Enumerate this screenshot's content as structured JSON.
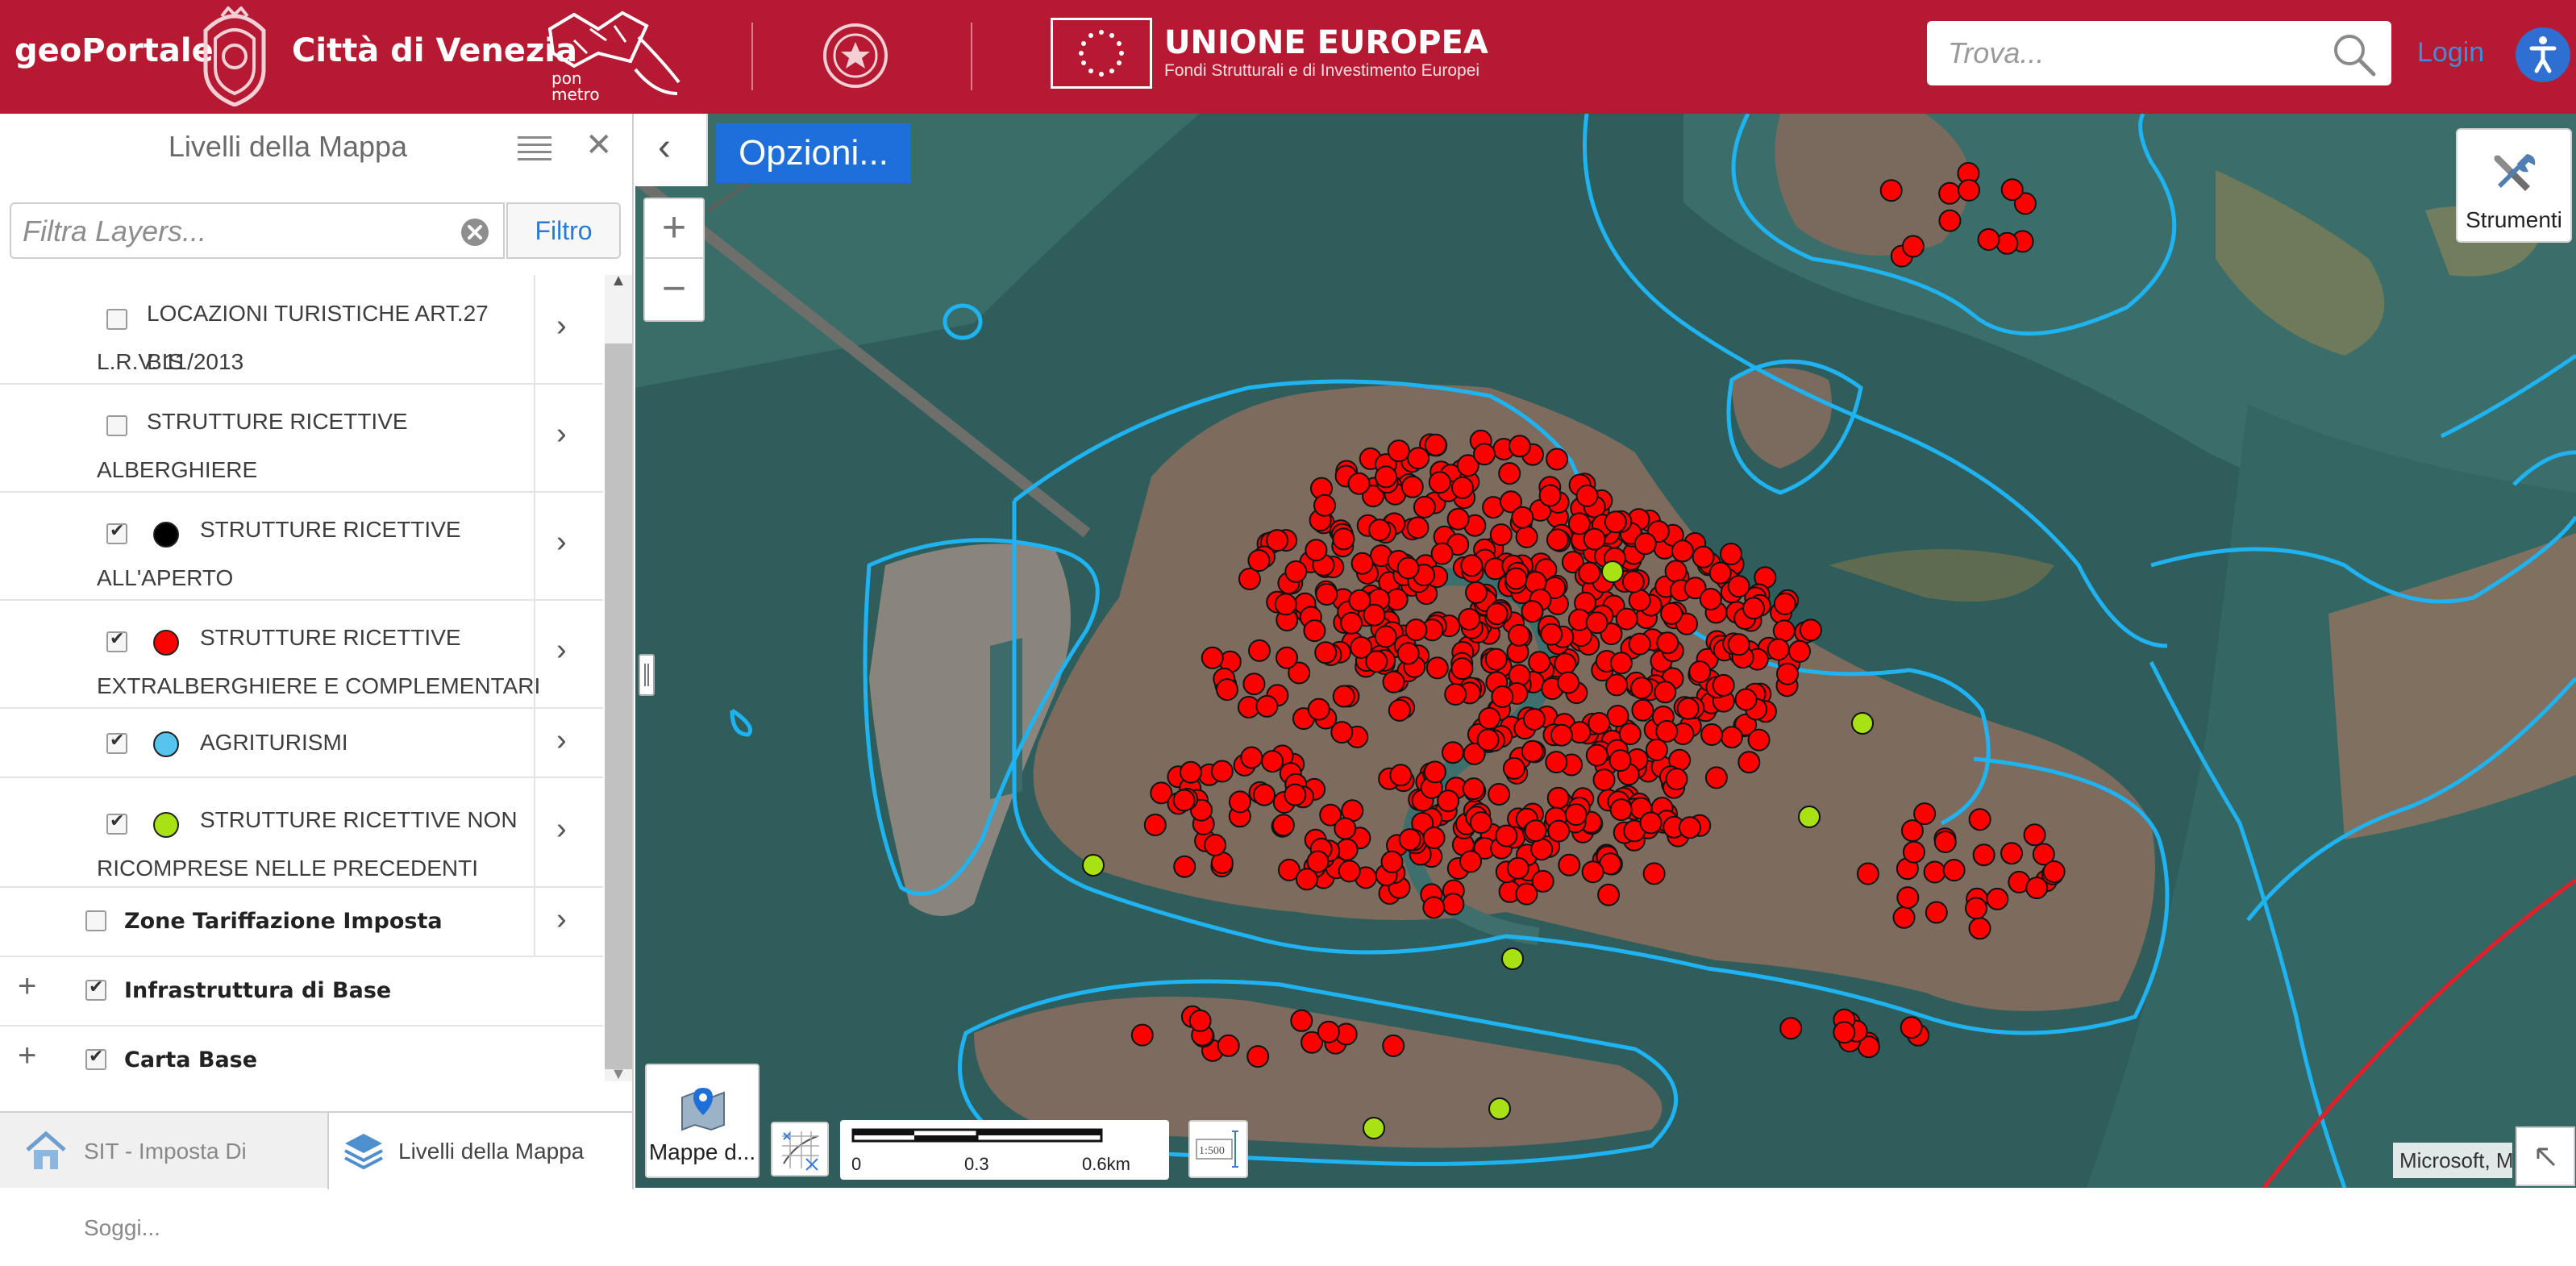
{
  "header": {
    "brand": "geoPortale",
    "city": "Città di Venezia",
    "eu_title": "UNIONE EUROPEA",
    "eu_subtitle": "Fondi Strutturali e di Investimento Europei",
    "pon_top": "pon",
    "pon_bottom": "metro",
    "search_placeholder": "Trova...",
    "login_label": "Login",
    "colors": {
      "bar": "#b61a32",
      "login": "#3d8ed8",
      "accessibility": "#2f6fd1"
    }
  },
  "sidebar": {
    "title": "Livelli della Mappa",
    "filter_placeholder": "Filtra Layers...",
    "filter_button": "Filtro",
    "layers": [
      {
        "line1": "LOCAZIONI TURISTICHE ART.27 BIS",
        "line2": "L.R.V. 11/2013",
        "checked": false,
        "color": ""
      },
      {
        "line1": "STRUTTURE RICETTIVE",
        "line2": "ALBERGHIERE",
        "checked": false,
        "color": ""
      },
      {
        "line1": "STRUTTURE RICETTIVE",
        "line2": "ALL'APERTO",
        "checked": true,
        "color": "#000000"
      },
      {
        "line1": "STRUTTURE RICETTIVE",
        "line2": "EXTRALBERGHIERE E COMPLEMENTARI",
        "checked": true,
        "color": "#ff0000"
      },
      {
        "line1": "AGRITURISMI",
        "line2": "",
        "checked": true,
        "color": "#55c5ee"
      },
      {
        "line1": "STRUTTURE RICETTIVE NON",
        "line2": "RICOMPRESE NELLE PRECEDENTI",
        "checked": true,
        "color": "#a8e214"
      }
    ],
    "groups": [
      {
        "label": "Zone Tariffazione Imposta",
        "checked": false
      },
      {
        "label": "Infrastruttura di Base",
        "checked": true
      },
      {
        "label": "Carta Base",
        "checked": true
      }
    ],
    "tabs": [
      {
        "label": "SIT - Imposta Di Soggi...",
        "icon": "home-icon"
      },
      {
        "label": "Livelli della Mappa",
        "icon": "layers-icon"
      }
    ]
  },
  "map": {
    "options_label": "Opzioni...",
    "tools_label": "Strumenti",
    "basemap_label": "Mappe d...",
    "scale_labels": [
      "0",
      "0.3",
      "0.6km"
    ],
    "scale_ratio_label": "1:500",
    "attribution": "Microsoft, M",
    "colors": {
      "water": "#2f5d5c",
      "boundary": "#1fb3f2",
      "poi_red": "#ff0000",
      "poi_green": "#a8e214",
      "rail": "#e0202a"
    }
  }
}
